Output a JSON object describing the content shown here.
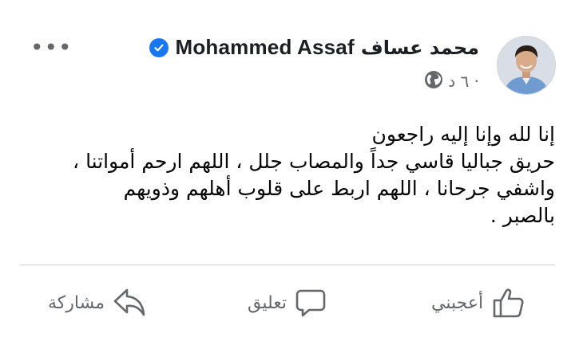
{
  "post": {
    "author_name_en": "Mohammed Assaf",
    "author_name_ar": "محمد عساف",
    "verified_icon": "verified-badge-icon",
    "time": "٦ د",
    "separator": "·",
    "privacy_icon": "globe-icon",
    "more_label": "•••",
    "body_lines": [
      "إنا لله وإنا إليه راجعون",
      "حريق جباليا قاسي جداً والمصاب جلل ، اللهم ارحم أمواتنا ،",
      "واشفي جرحانا ، اللهم اربط على قلوب أهلهم وذويهم",
      "بالصبر ."
    ]
  },
  "actions": {
    "like_label": "أعجبني",
    "comment_label": "تعليق",
    "share_label": "مشاركة"
  },
  "colors": {
    "accent": "#1877f2",
    "secondary_text": "#65676b",
    "divider": "#ced0d4"
  }
}
